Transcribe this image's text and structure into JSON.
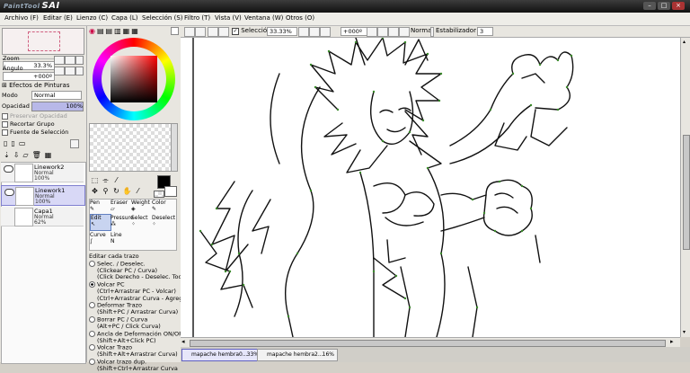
{
  "app": {
    "logo_prefix": "PaintTool",
    "logo_name": "SAI"
  },
  "menu": [
    "Archivo (F)",
    "Editar (E)",
    "Lienzo (C)",
    "Capa (L)",
    "Selección (S)",
    "Filtro (T)",
    "Vista (V)",
    "Ventana (W)",
    "Otros (O)"
  ],
  "navigator": {
    "zoom_label": "Zoom",
    "zoom_value": "33.3%",
    "angle_label": "Ángulo",
    "angle_value": "+000º"
  },
  "effects": {
    "label": "Efectos de Pinturas"
  },
  "layer_props": {
    "mode_label": "Modo",
    "mode_value": "Normal",
    "opacity_label": "Opacidad",
    "opacity_value": "100%",
    "preserve_opacity": "Preservar Opacidad",
    "clip_group": "Recortar Grupo",
    "selection_source": "Fuente de Selección"
  },
  "layers": [
    {
      "name": "Linework2",
      "mode": "Normal",
      "opacity": "100%"
    },
    {
      "name": "Linework1",
      "mode": "Normal",
      "opacity": "100%"
    },
    {
      "name": "Capa1",
      "mode": "Normal",
      "opacity": "62%"
    }
  ],
  "brushes": {
    "row1": [
      "Pen",
      "Eraser",
      "Weight",
      "Color"
    ],
    "row2": [
      "Edit",
      "Pressure",
      "Select",
      "Deselect"
    ],
    "row3": [
      "Curve",
      "Line"
    ]
  },
  "edit_options": {
    "title": "Editar cada trazo",
    "lines": [
      {
        "text": "Selec. / Deselec.",
        "radio": true,
        "on": false
      },
      {
        "text": "(Clickear PC / Curva)",
        "radio": false
      },
      {
        "text": "(Click Derecho - Deselec. Todo)",
        "radio": false
      },
      {
        "text": "Volcar PC",
        "radio": true,
        "on": true
      },
      {
        "text": "(Ctrl+Arrastrar PC - Volcar)",
        "radio": false
      },
      {
        "text": "(Ctrl+Arrastrar Curva - Agregar/V",
        "radio": false
      },
      {
        "text": "Deformar Trazo",
        "radio": true,
        "on": false
      },
      {
        "text": "(Shift+PC / Arrastrar Curva)",
        "radio": false
      },
      {
        "text": "Borrar PC / Curva",
        "radio": true,
        "on": false
      },
      {
        "text": "(Alt+PC / Click Curva)",
        "radio": false
      },
      {
        "text": "Ancla de Deformación ON/OFF",
        "radio": true,
        "on": false
      },
      {
        "text": "(Shift+Alt+Click PC)",
        "radio": false
      },
      {
        "text": "Volcar Trazo",
        "radio": true,
        "on": false
      },
      {
        "text": "(Shift+Alt+Arrastrar Curva)",
        "radio": false
      },
      {
        "text": "Volcar trazo dup.",
        "radio": true,
        "on": false
      },
      {
        "text": "(Shift+Ctrl+Arrastrar Curva",
        "radio": false
      }
    ]
  },
  "canvas_toolbar": {
    "selection_label": "Selección",
    "zoom": "33.33%",
    "angle": "+000º",
    "mode": "Normal",
    "stabilizer_label": "Estabilizador",
    "stabilizer_value": "3"
  },
  "doc_tabs": [
    {
      "name": "mapache hembra0...",
      "zoom": "33%"
    },
    {
      "name": "mapache hembra2...",
      "zoom": "16%"
    }
  ],
  "colors": {
    "accent": "#6060c0",
    "panel": "#e8e6e0",
    "line": "#111111",
    "control_point": "#3a8a2a"
  }
}
